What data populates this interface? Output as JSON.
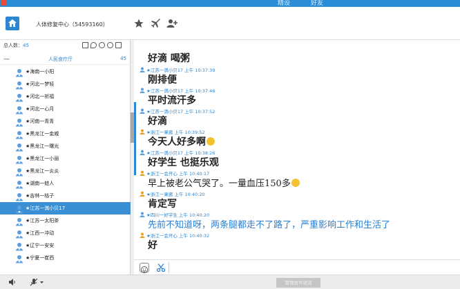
{
  "top_tabs": [
    "精设",
    "好友"
  ],
  "header": {
    "group_name": "人体修复中心（54593160）",
    "icons": [
      "home-icon",
      "star-icon",
      "plane-icon",
      "add-user-icon"
    ]
  },
  "members": {
    "label": "总人数：",
    "count": "45",
    "tool_icons": [
      "card-icon",
      "location-icon",
      "user-icon",
      "search-icon",
      "edit-icon"
    ]
  },
  "group": {
    "collapse": "—",
    "name": "人民食疗厅",
    "count": "45",
    "items": [
      {
        "name": "★海南一小阳"
      },
      {
        "name": "★河北一梦轻"
      },
      {
        "name": "★河北一祈福"
      },
      {
        "name": "★河北一心月"
      },
      {
        "name": "★河南一青青"
      },
      {
        "name": "★黑龙江一金威"
      },
      {
        "name": "★黑龙江一曙光"
      },
      {
        "name": "★黑龙江一小丽"
      },
      {
        "name": "★黑龙江一炎炎"
      },
      {
        "name": "★湖南一蛙人"
      },
      {
        "name": "★吉林一桔子"
      },
      {
        "name": "★江苏一満小贝17"
      },
      {
        "name": "★江苏一太阳茶"
      },
      {
        "name": "★江西一冲动"
      },
      {
        "name": "★辽宁一安安"
      },
      {
        "name": "★宁夏一崔西"
      }
    ],
    "selected_index": 11
  },
  "messages": [
    {
      "meta": "",
      "text": "好滴  喝粥"
    },
    {
      "meta": "★江苏一満小贝17 上午 10:37:39",
      "text": "刚排便"
    },
    {
      "meta": "★江苏一満小贝17 上午 10:37:46",
      "text": "平时流汗多"
    },
    {
      "meta": "★江苏一満小贝17 上午 10:37:52",
      "text": "好滴"
    },
    {
      "meta": "★浙江一果酱 上午 10:39:52",
      "text": "今天人好多啊"
    },
    {
      "meta": "★江苏一満小贝17 上午 10:38:26",
      "text": "好学生  也挺乐观"
    },
    {
      "meta": "★浙江一会开心 上午 10:40:17",
      "text": "早上被老公气哭了。一量血压150多"
    },
    {
      "meta": "★浙江一果酱 上午 10:40:20",
      "text": "肯定写"
    },
    {
      "meta": "★四川一好学生 上午 10:40:20",
      "text": "先前不知道呀，两条腿都走不了路了，严重影响工作和生活了"
    },
    {
      "meta": "★浙江一会开心 上午 10:40:32",
      "text": "好"
    }
  ],
  "input": {
    "emoji_icon": "smiley-icon",
    "scissors_icon": "scissors-icon"
  },
  "bottom": {
    "admin_button": "管理员可说话"
  },
  "colors": {
    "accent": "#2d86d1",
    "selected_row": "#3a8fd4",
    "blue_text": "#2a7fd3"
  }
}
